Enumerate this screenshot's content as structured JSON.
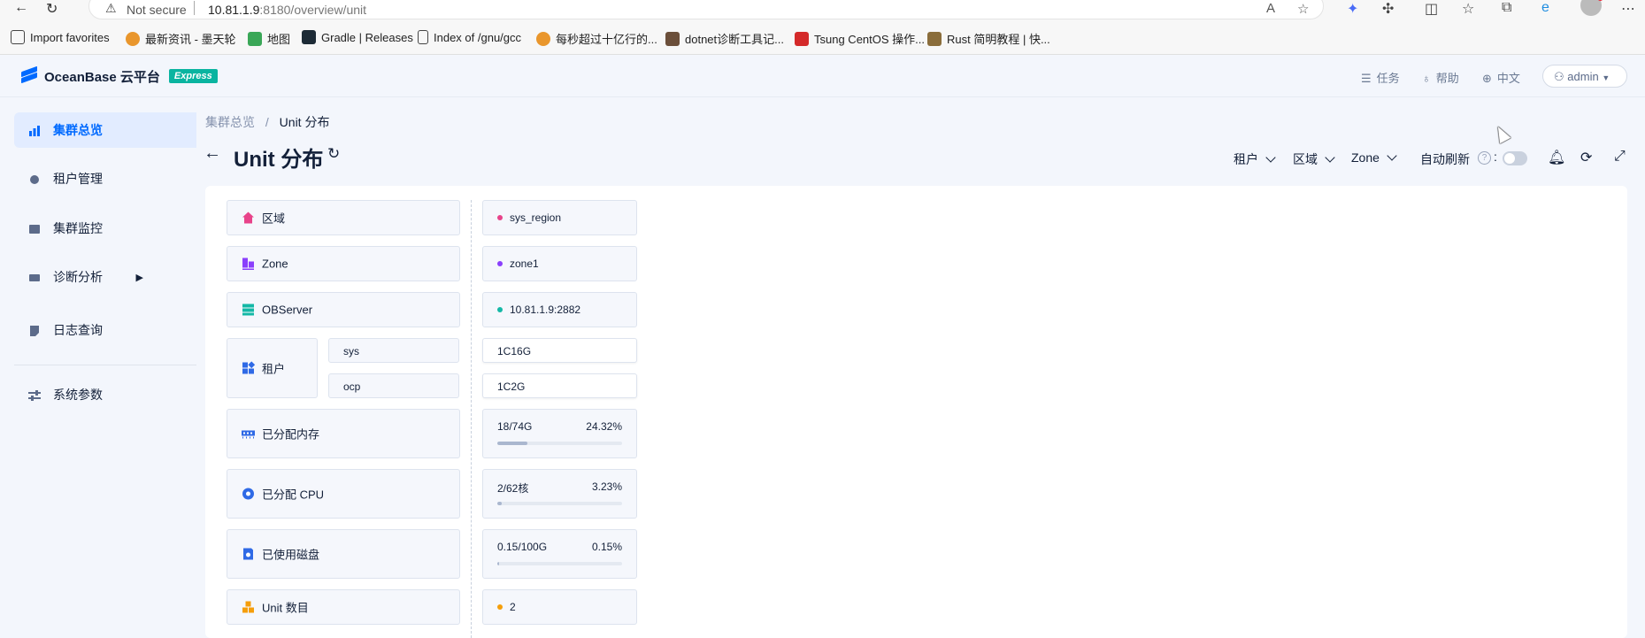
{
  "browser": {
    "not_secure": "Not secure",
    "url_host": "10.81.1.9",
    "url_rest": ":8180/overview/unit",
    "bookmarks": [
      {
        "label": "Import favorites",
        "icon": "import-icon"
      },
      {
        "label": "最新资讯 - 墨天轮",
        "icon": "modb-icon"
      },
      {
        "label": "地图",
        "icon": "map-icon"
      },
      {
        "label": "Gradle | Releases",
        "icon": "gradle-icon"
      },
      {
        "label": "Index of /gnu/gcc",
        "icon": "page-icon"
      },
      {
        "label": "每秒超过十亿行的...",
        "icon": "modb-icon"
      },
      {
        "label": "dotnet诊断工具记...",
        "icon": "blog-icon"
      },
      {
        "label": "Tsung CentOS 操作...",
        "icon": "51cto-icon"
      },
      {
        "label": "Rust 简明教程 | 快...",
        "icon": "rust-icon"
      }
    ]
  },
  "header": {
    "logo_text": "OceanBase 云平台",
    "badge": "Express",
    "tasks": "任务",
    "help": "帮助",
    "lang": "中文",
    "user": "admin"
  },
  "sidebar": {
    "items": [
      {
        "label": "集群总览",
        "icon": "bar-chart-icon",
        "active": true
      },
      {
        "label": "租户管理",
        "icon": "tenant-icon"
      },
      {
        "label": "集群监控",
        "icon": "monitor-icon"
      },
      {
        "label": "诊断分析",
        "icon": "diagnose-icon"
      },
      {
        "label": "日志查询",
        "icon": "log-icon"
      },
      {
        "label": "系统参数",
        "icon": "settings-icon"
      }
    ]
  },
  "page": {
    "breadcrumb_parent": "集群总览",
    "breadcrumb_sep": "/",
    "breadcrumb_current": "Unit 分布",
    "title": "Unit 分布",
    "filters": [
      "租户",
      "区域",
      "Zone"
    ],
    "auto_refresh": "自动刷新",
    "auto_refresh_on": false
  },
  "unit": {
    "labels": {
      "region": "区域",
      "zone": "Zone",
      "observer": "OBServer",
      "tenant": "租户",
      "memory": "已分配内存",
      "cpu": "已分配 CPU",
      "disk": "已使用磁盘",
      "unit_count": "Unit 数目"
    },
    "region": {
      "name": "sys_region",
      "color": "#e8438a"
    },
    "zone": {
      "name": "zone1",
      "color": "#8a3ffc"
    },
    "observer": {
      "name": "10.81.1.9:2882",
      "color": "#14b8a6"
    },
    "tenants": [
      {
        "name": "sys",
        "spec": "1C16G"
      },
      {
        "name": "ocp",
        "spec": "1C2G"
      }
    ],
    "memory": {
      "used": "18/74G",
      "percent_text": "24.32%",
      "percent": 24.32
    },
    "cpu": {
      "used": "2/62核",
      "percent_text": "3.23%",
      "percent": 3.23
    },
    "disk": {
      "used": "0.15/100G",
      "percent_text": "0.15%",
      "percent": 0.15
    },
    "unit_count": {
      "value": "2",
      "color": "#f59e0b"
    }
  }
}
